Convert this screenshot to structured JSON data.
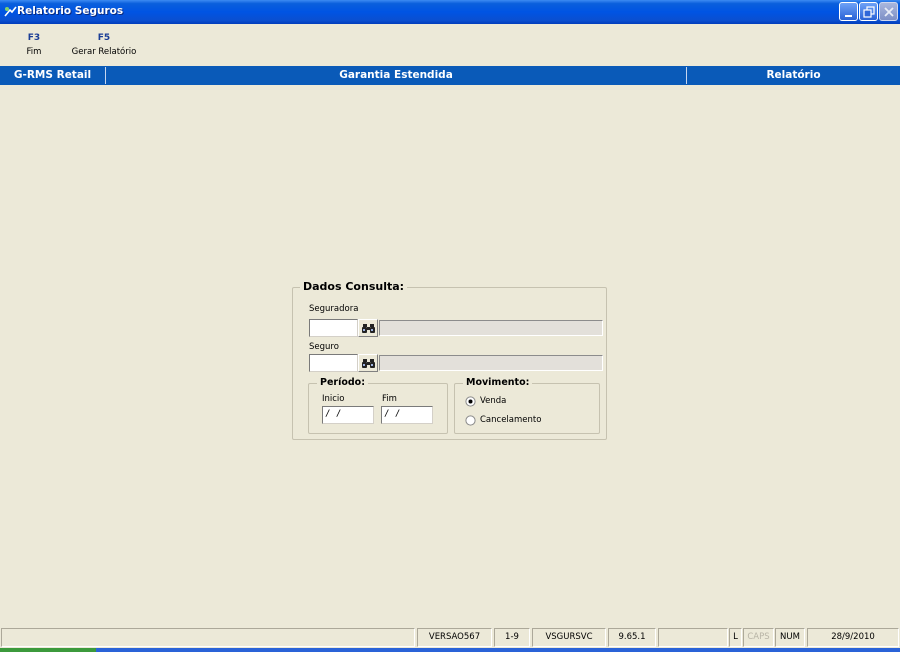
{
  "window": {
    "title": "Relatorio Seguros"
  },
  "toolbar": {
    "f3": {
      "key": "F3",
      "label": "Fim"
    },
    "f5": {
      "key": "F5",
      "label": "Gerar Relatório"
    }
  },
  "header": {
    "left": "G-RMS Retail",
    "center": "Garantia Estendida",
    "right": "Relatório"
  },
  "form": {
    "group_title": "Dados Consulta:",
    "seguradora": {
      "label": "Seguradora",
      "code_value": "",
      "description": ""
    },
    "seguro": {
      "label": "Seguro",
      "code_value": "",
      "description": ""
    },
    "periodo": {
      "title": "Período:",
      "inicio_label": "Inicio",
      "inicio_value": " / /",
      "fim_label": "Fim",
      "fim_value": " / /"
    },
    "movimento": {
      "title": "Movimento:",
      "options": [
        "Venda",
        "Cancelamento"
      ],
      "selected": "Venda"
    }
  },
  "statusbar": {
    "version": "VERSAO567",
    "code": "1-9",
    "service": "VSGURSVC",
    "build": "9.65.1",
    "l": "L",
    "caps": "CAPS",
    "num": "NUM",
    "date": "28/9/2010"
  },
  "colors": {
    "titlebar": "#0054e3",
    "header_strip": "#0a5ab8",
    "background": "#ece9d8",
    "fkey_text": "#1a3d96"
  },
  "icons": {
    "app": "app-icon",
    "lookup": "binoculars-icon",
    "minimize": "minimize-icon",
    "restore": "restore-icon",
    "close": "close-icon"
  }
}
